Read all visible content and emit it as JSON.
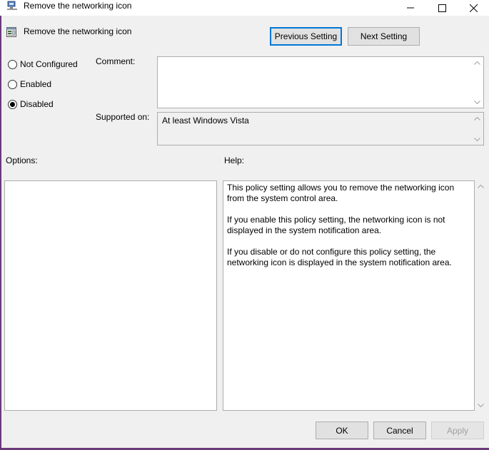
{
  "window": {
    "title": "Remove the networking icon",
    "controls": {
      "minimize": "minimize-icon",
      "maximize": "maximize-icon",
      "close": "close-icon"
    }
  },
  "header": {
    "policy_name": "Remove the networking icon",
    "prev_label": "Previous Setting",
    "next_label": "Next Setting"
  },
  "state": {
    "options": [
      {
        "label": "Not Configured",
        "checked": false
      },
      {
        "label": "Enabled",
        "checked": false
      },
      {
        "label": "Disabled",
        "checked": true
      }
    ]
  },
  "comment": {
    "label": "Comment:",
    "value": ""
  },
  "supported": {
    "label": "Supported on:",
    "value": "At least Windows Vista"
  },
  "options_panel": {
    "label": "Options:"
  },
  "help": {
    "label": "Help:",
    "paragraphs": [
      "This policy setting allows you to remove the networking icon from the system control area.",
      "If you enable this policy setting, the networking icon is not displayed in the system notification area.",
      "If you disable or do not configure this policy setting, the networking icon is displayed in the system notification area."
    ]
  },
  "footer": {
    "ok_label": "OK",
    "cancel_label": "Cancel",
    "apply_label": "Apply"
  },
  "colors": {
    "focus_border": "#0078d7",
    "dialog_bg": "#f0f0f0",
    "frame": "#6b3a7a"
  }
}
